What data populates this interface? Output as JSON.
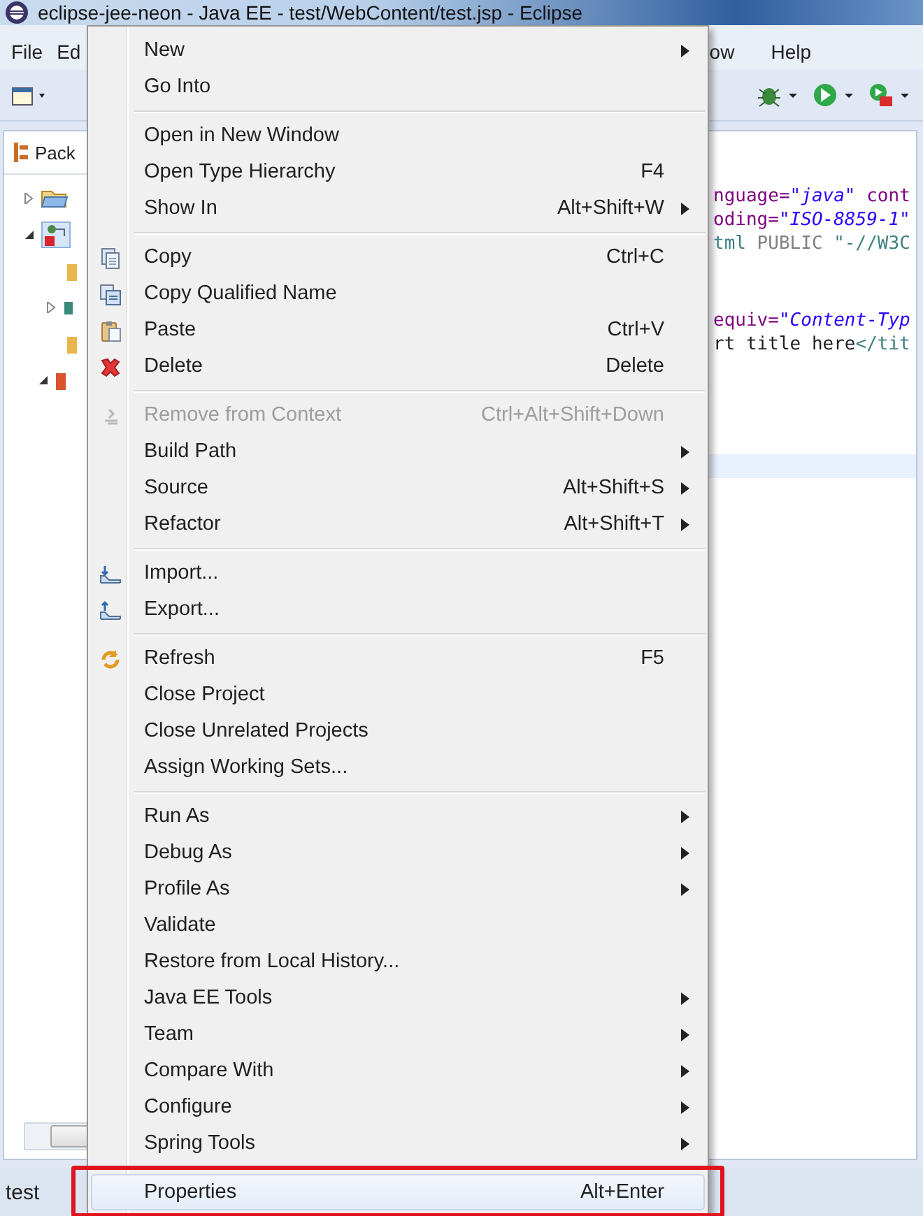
{
  "window": {
    "title": "eclipse-jee-neon - Java EE - test/WebContent/test.jsp - Eclipse"
  },
  "menu_bar": [
    "File",
    "Ed",
    "ow",
    "Help"
  ],
  "package_explorer": {
    "tab": "Pack"
  },
  "editor": {
    "lines": [
      {
        "segments": [
          {
            "text": "nguage=",
            "kind": "attr"
          },
          {
            "text": "\"java\"",
            "kind": "string"
          },
          {
            "text": " cont",
            "kind": "attr"
          }
        ]
      },
      {
        "segments": [
          {
            "text": "oding=",
            "kind": "attr"
          },
          {
            "text": "\"ISO-8859-1\"",
            "kind": "string"
          }
        ]
      },
      {
        "segments": [
          {
            "text": "tml",
            "kind": "tag"
          },
          {
            "text": " PUBLIC ",
            "kind": "doctype"
          },
          {
            "text": "\"-//W3C",
            "kind": "tag"
          }
        ]
      },
      {
        "segments": [
          {
            "text": "equiv=",
            "kind": "attr"
          },
          {
            "text": "\"Content-Typ",
            "kind": "string"
          }
        ]
      },
      {
        "segments": [
          {
            "text": "rt title here",
            "kind": "plain"
          },
          {
            "text": "</tit",
            "kind": "tag"
          }
        ]
      }
    ]
  },
  "context_menu": {
    "groups": [
      [
        {
          "label": "New",
          "submenu": true,
          "disabled": false,
          "selected": false
        },
        {
          "label": "Go Into",
          "submenu": false,
          "disabled": false,
          "selected": false
        }
      ],
      [
        {
          "label": "Open in New Window",
          "submenu": false,
          "disabled": false,
          "selected": false
        },
        {
          "label": "Open Type Hierarchy",
          "shortcut": "F4",
          "submenu": false,
          "disabled": false,
          "selected": false
        },
        {
          "label": "Show In",
          "shortcut": "Alt+Shift+W",
          "submenu": true,
          "disabled": false,
          "selected": false
        }
      ],
      [
        {
          "label": "Copy",
          "shortcut": "Ctrl+C",
          "submenu": false,
          "disabled": false,
          "selected": false
        },
        {
          "label": "Copy Qualified Name",
          "submenu": false,
          "disabled": false,
          "selected": false
        },
        {
          "label": "Paste",
          "shortcut": "Ctrl+V",
          "submenu": false,
          "disabled": false,
          "selected": false
        },
        {
          "label": "Delete",
          "shortcut": "Delete",
          "submenu": false,
          "disabled": false,
          "selected": false
        }
      ],
      [
        {
          "label": "Remove from Context",
          "shortcut": "Ctrl+Alt+Shift+Down",
          "submenu": false,
          "disabled": true,
          "selected": false
        },
        {
          "label": "Build Path",
          "submenu": true,
          "disabled": false,
          "selected": false
        },
        {
          "label": "Source",
          "shortcut": "Alt+Shift+S",
          "submenu": true,
          "disabled": false,
          "selected": false
        },
        {
          "label": "Refactor",
          "shortcut": "Alt+Shift+T",
          "submenu": true,
          "disabled": false,
          "selected": false
        }
      ],
      [
        {
          "label": "Import...",
          "submenu": false,
          "disabled": false,
          "selected": false
        },
        {
          "label": "Export...",
          "submenu": false,
          "disabled": false,
          "selected": false
        }
      ],
      [
        {
          "label": "Refresh",
          "shortcut": "F5",
          "submenu": false,
          "disabled": false,
          "selected": false
        },
        {
          "label": "Close Project",
          "submenu": false,
          "disabled": false,
          "selected": false
        },
        {
          "label": "Close Unrelated Projects",
          "submenu": false,
          "disabled": false,
          "selected": false
        },
        {
          "label": "Assign Working Sets...",
          "submenu": false,
          "disabled": false,
          "selected": false
        }
      ],
      [
        {
          "label": "Run As",
          "submenu": true,
          "disabled": false,
          "selected": false
        },
        {
          "label": "Debug As",
          "submenu": true,
          "disabled": false,
          "selected": false
        },
        {
          "label": "Profile As",
          "submenu": true,
          "disabled": false,
          "selected": false
        },
        {
          "label": "Validate",
          "submenu": false,
          "disabled": false,
          "selected": false
        },
        {
          "label": "Restore from Local History...",
          "submenu": false,
          "disabled": false,
          "selected": false
        },
        {
          "label": "Java EE Tools",
          "submenu": true,
          "disabled": false,
          "selected": false
        },
        {
          "label": "Team",
          "submenu": true,
          "disabled": false,
          "selected": false
        },
        {
          "label": "Compare With",
          "submenu": true,
          "disabled": false,
          "selected": false
        },
        {
          "label": "Configure",
          "submenu": true,
          "disabled": false,
          "selected": false
        },
        {
          "label": "Spring Tools",
          "submenu": true,
          "disabled": false,
          "selected": false
        }
      ],
      [
        {
          "label": "Properties",
          "shortcut": "Alt+Enter",
          "submenu": false,
          "disabled": false,
          "selected": true
        }
      ]
    ]
  },
  "status_bar": {
    "text": "test"
  }
}
